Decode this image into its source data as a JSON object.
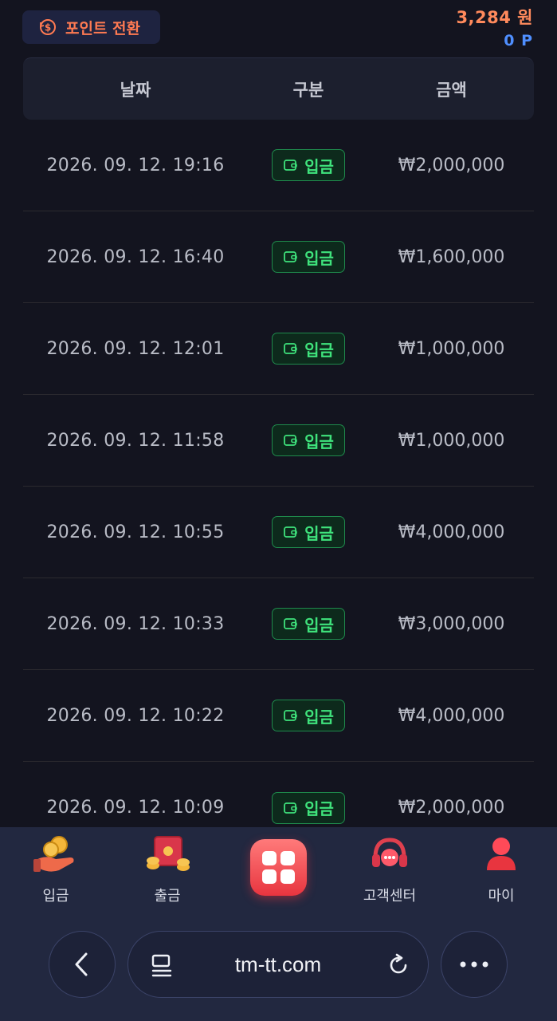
{
  "header": {
    "point_convert_label": "포인트 전환",
    "balance_won": "3,284 원",
    "balance_points": "0 P"
  },
  "table": {
    "columns": [
      "날짜",
      "구분",
      "금액"
    ],
    "rows": [
      {
        "date": "2026. 09. 12. 19:16",
        "type": "입금",
        "amount": "₩2,000,000"
      },
      {
        "date": "2026. 09. 12. 16:40",
        "type": "입금",
        "amount": "₩1,600,000"
      },
      {
        "date": "2026. 09. 12. 12:01",
        "type": "입금",
        "amount": "₩1,000,000"
      },
      {
        "date": "2026. 09. 12. 11:58",
        "type": "입금",
        "amount": "₩1,000,000"
      },
      {
        "date": "2026. 09. 12. 10:55",
        "type": "입금",
        "amount": "₩4,000,000"
      },
      {
        "date": "2026. 09. 12. 10:33",
        "type": "입금",
        "amount": "₩3,000,000"
      },
      {
        "date": "2026. 09. 12. 10:22",
        "type": "입금",
        "amount": "₩4,000,000"
      },
      {
        "date": "2026. 09. 12. 10:09",
        "type": "입금",
        "amount": "₩2,000,000"
      }
    ]
  },
  "bottom_nav": {
    "items": [
      {
        "label": "입금",
        "icon": "deposit-coins-icon"
      },
      {
        "label": "출금",
        "icon": "withdraw-safe-icon"
      },
      {
        "label": "",
        "icon": "menu-grid-icon"
      },
      {
        "label": "고객센터",
        "icon": "support-headset-icon"
      },
      {
        "label": "마이",
        "icon": "user-icon"
      }
    ]
  },
  "browser": {
    "url": "tm-tt.com"
  },
  "colors": {
    "background": "#13141f",
    "accent_orange": "#ff7a52",
    "points_blue": "#4f8fff",
    "badge_green": "#3fe37c",
    "nav_background": "#222840"
  }
}
